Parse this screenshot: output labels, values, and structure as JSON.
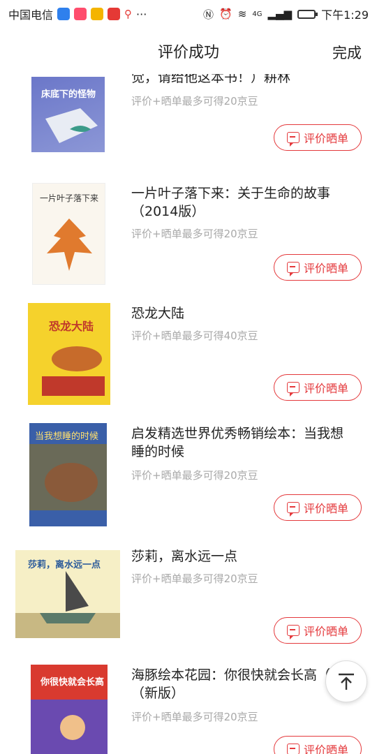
{
  "status_bar": {
    "carrier": "中国电信",
    "time": "下午1:29",
    "signal_label": "4G",
    "more": "···"
  },
  "header": {
    "title": "评价成功",
    "done_label": "完成"
  },
  "items": [
    {
      "title": "觉，请给他这本书！）耕林",
      "subtitle": "评价+晒单最多可得20京豆",
      "button_label": "评价晒单",
      "cover_title": "床底下的怪物"
    },
    {
      "title": "一片叶子落下来：关于生命的故事（2014版）",
      "subtitle": "评价+晒单最多可得20京豆",
      "button_label": "评价晒单",
      "cover_title": "一片叶子落下来"
    },
    {
      "title": "恐龙大陆",
      "subtitle": "评价+晒单最多可得40京豆",
      "button_label": "评价晒单",
      "cover_title": "恐龙大陆"
    },
    {
      "title": "启发精选世界优秀畅销绘本：当我想睡的时候",
      "subtitle": "评价+晒单最多可得20京豆",
      "button_label": "评价晒单",
      "cover_title": "当我想睡的时候"
    },
    {
      "title": "莎莉，离水远一点",
      "subtitle": "评价+晒单最多可得20京豆",
      "button_label": "评价晒单",
      "cover_title": "莎莉，离水远一点"
    },
    {
      "title": "海豚绘本花园：你很快就会长高（精）（新版）",
      "subtitle": "评价+晒单最多可得20京豆",
      "button_label": "评价晒单",
      "cover_title": "你很快就会长高"
    }
  ],
  "icons": {
    "back_to_top": "arrow-up-icon",
    "comment": "comment-icon"
  },
  "colors": {
    "accent": "#e4393c",
    "subtle_text": "#a9a9a9"
  }
}
